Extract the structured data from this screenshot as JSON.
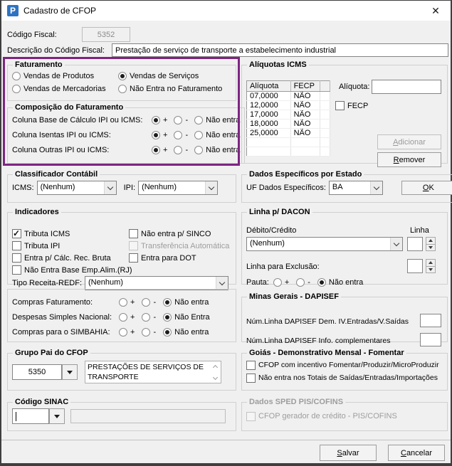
{
  "window": {
    "title": "Cadastro de CFOP",
    "close_glyph": "✕",
    "logo_letter": "P"
  },
  "header": {
    "codigo_fiscal_label": "Código Fiscal:",
    "codigo_fiscal_value": "5352",
    "descricao_label": "Descrição do Código Fiscal:",
    "descricao_value": "Prestação de serviço de transporte a estabelecimento industrial"
  },
  "left": {
    "faturamento": {
      "title": "Faturamento",
      "opt1": "Vendas de Produtos",
      "opt2": "Vendas de Serviços",
      "opt3": "Vendas de Mercadorias",
      "opt4": "Não Entra no Faturamento",
      "selected": "Vendas de Serviços"
    },
    "composicao": {
      "title": "Composição do Faturamento",
      "plus": "+",
      "minus": "-",
      "rows": [
        {
          "label": "Coluna Base de Cálculo IPI ou ICMS:",
          "nao": "Não entra",
          "selected": "+"
        },
        {
          "label": "Coluna Isentas IPI ou ICMS:",
          "nao": "Não entra",
          "selected": "+"
        },
        {
          "label": "Coluna Outras IPI ou ICMS:",
          "nao": "Não entra",
          "selected": "+"
        }
      ]
    },
    "classificador": {
      "title": "Classificador Contábil",
      "icms_label": "ICMS:",
      "icms_value": "(Nenhum)",
      "ipi_label": "IPI:",
      "ipi_value": "(Nenhum)"
    },
    "indicadores": {
      "title": "Indicadores",
      "cb1": "Tributa ICMS",
      "cb2": "Tributa IPI",
      "cb3": "Entra p/ Cálc. Rec. Bruta",
      "cb4": "Não Entra Base Emp.Alim.(RJ)",
      "cb5": "Não entra p/ SINCO",
      "cb6": "Transferência Automática",
      "cb7": "Entra para DOT",
      "checked": [
        "Tributa ICMS"
      ],
      "tipo_receita_label": "Tipo Receita-REDF:",
      "tipo_receita_value": "(Nenhum)"
    },
    "compras": {
      "plus": "+",
      "minus": "-",
      "rows": [
        {
          "label": "Compras Faturamento:",
          "nao": "Não entra",
          "selected": "Não entra"
        },
        {
          "label": "Despesas Simples Nacional:",
          "nao": "Não Entra",
          "selected": "Não Entra"
        },
        {
          "label": "Compras para o SIMBAHIA:",
          "nao": "Não entra",
          "selected": "Não entra"
        }
      ]
    },
    "grupo_pai": {
      "title": "Grupo Pai do CFOP",
      "codigo": "5350",
      "descricao": "PRESTAÇÕES DE SERVIÇOS DE TRANSPORTE"
    },
    "codigo_sinac": {
      "title": "Código SINAC",
      "codigo": "",
      "descricao": ""
    }
  },
  "right": {
    "aliquotas": {
      "title": "Alíquotas ICMS",
      "col1": "Alíquota",
      "col2": "FECP",
      "rows": [
        [
          "07,0000",
          "NÃO"
        ],
        [
          "12,0000",
          "NÃO"
        ],
        [
          "17,0000",
          "NÃO"
        ],
        [
          "18,0000",
          "NÃO"
        ],
        [
          "25,0000",
          "NÃO"
        ]
      ],
      "aliquota_label": "Alíquota:",
      "aliquota_value": "",
      "fecp_label": "FECP",
      "fecp_checked": false,
      "adicionar": "Adicionar",
      "remover": "Remover"
    },
    "dados_estado": {
      "title": "Dados Específicos por Estado",
      "uf_label": "UF Dados Específicos:",
      "uf_value": "BA",
      "ok": "OK"
    },
    "dacon": {
      "title": "Linha p/ DACON",
      "debito_label": "Débito/Crédito",
      "debito_value": "(Nenhum)",
      "linha_label": "Linha",
      "linha_value": "",
      "exclusao_label": "Linha para Exclusão:",
      "exclusao_value": "",
      "pauta_label": "Pauta:",
      "plus": "+",
      "minus": "-",
      "nao": "Não entra",
      "pauta_selected": "Não entra"
    },
    "minas": {
      "title": "Minas Gerais - DAPISEF",
      "row1_label": "Núm.Linha DAPISEF Dem. IV.Entradas/V.Saídas",
      "row1_value": "",
      "row2_label": "Núm.Linha DAPISEF Info. complementares",
      "row2_value": ""
    },
    "goias": {
      "title": "Goiás - Demonstrativo Mensal - Fomentar",
      "cb1": "CFOP com incentivo Fomentar/Produzir/MicroProduzir",
      "cb2": "Não entra nos Totais de Saídas/Entradas/Importações"
    },
    "sped": {
      "title": "Dados SPED PIS/COFINS",
      "cb1": "CFOP gerador de crédito - PIS/COFINS"
    }
  },
  "footer": {
    "salvar": "Salvar",
    "cancelar": "Cancelar"
  }
}
